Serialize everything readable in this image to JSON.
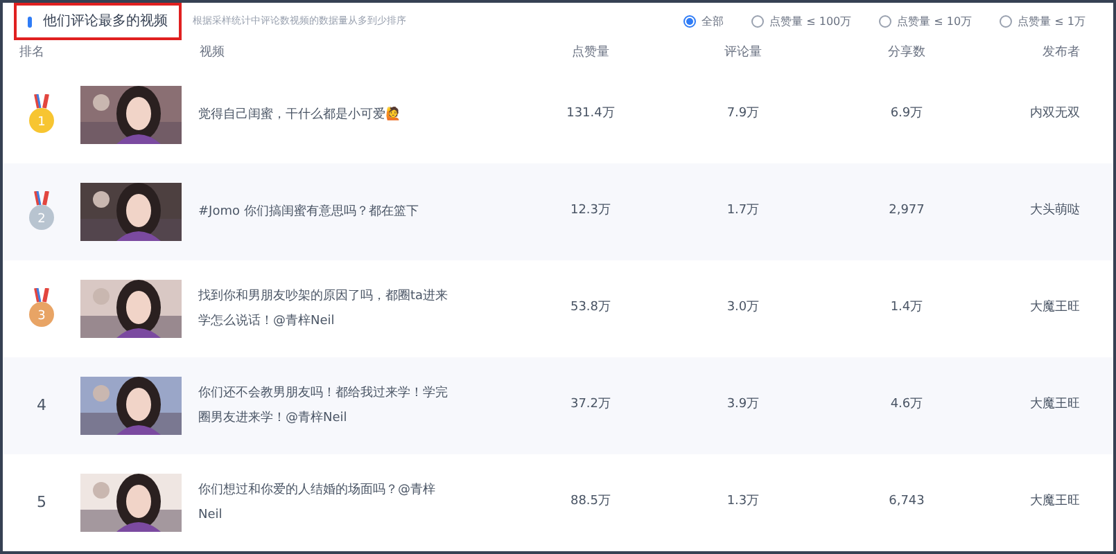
{
  "panel": {
    "title": "他们评论最多的视频",
    "subtitle": "根据采样统计中评论数视频的数据量从多到少排序"
  },
  "filters": [
    {
      "label": "全部",
      "selected": true
    },
    {
      "label": "点赞量 ≤ 100万",
      "selected": false
    },
    {
      "label": "点赞量 ≤ 10万",
      "selected": false
    },
    {
      "label": "点赞量 ≤ 1万",
      "selected": false
    }
  ],
  "table": {
    "columns": [
      "排名",
      "视频",
      "点赞量",
      "评论量",
      "分享数",
      "发布者"
    ],
    "rows": [
      {
        "rank": {
          "kind": "medal",
          "label": "1",
          "color": "#f7c531"
        },
        "title": "觉得自己闺蜜，干什么都是小可爱🙋",
        "likes": "131.4万",
        "comments": "7.9万",
        "shares": "6.9万",
        "author": "内双无双"
      },
      {
        "rank": {
          "kind": "medal",
          "label": "2",
          "color": "#b8c4d0"
        },
        "title": "#Jomo 你们搞闺蜜有意思吗？都在篮下",
        "likes": "12.3万",
        "comments": "1.7万",
        "shares": "2,977",
        "author": "大头萌哒"
      },
      {
        "rank": {
          "kind": "medal",
          "label": "3",
          "color": "#e8a465"
        },
        "title": "找到你和男朋友吵架的原因了吗，都圈ta进来学怎么说话！@青梓Neil",
        "likes": "53.8万",
        "comments": "3.0万",
        "shares": "1.4万",
        "author": "大魔王旺"
      },
      {
        "rank": {
          "kind": "number",
          "label": "4"
        },
        "title": "你们还不会教男朋友吗！都给我过来学！学完圈男友进来学！@青梓Neil",
        "likes": "37.2万",
        "comments": "3.9万",
        "shares": "4.6万",
        "author": "大魔王旺"
      },
      {
        "rank": {
          "kind": "number",
          "label": "5"
        },
        "title": "你们想过和你爱的人结婚的场面吗？@青梓Neil",
        "likes": "88.5万",
        "comments": "1.3万",
        "shares": "6,743",
        "author": "大魔王旺"
      }
    ]
  }
}
